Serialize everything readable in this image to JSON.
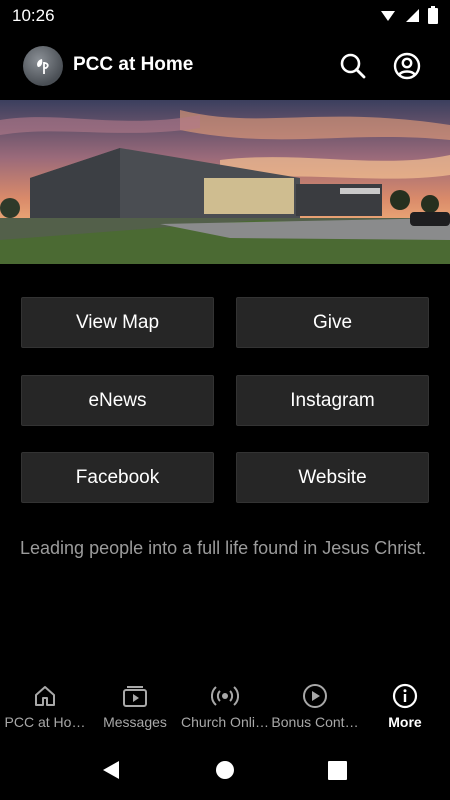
{
  "status_bar": {
    "time": "10:26"
  },
  "app_bar": {
    "title": "PCC at Home",
    "icons": [
      "search-icon",
      "account-icon"
    ]
  },
  "hero": {
    "icon": "church-building-photo"
  },
  "actions": [
    {
      "label": "View Map"
    },
    {
      "label": "Give"
    },
    {
      "label": "eNews"
    },
    {
      "label": "Instagram"
    },
    {
      "label": "Facebook"
    },
    {
      "label": "Website"
    }
  ],
  "tagline": "Leading people into a full life found in Jesus Christ.",
  "bottom_nav": {
    "items": [
      {
        "label": "PCC at Ho…",
        "icon": "home-icon",
        "active": false
      },
      {
        "label": "Messages",
        "icon": "video-library-icon",
        "active": false
      },
      {
        "label": "Church Onli…",
        "icon": "broadcast-icon",
        "active": false
      },
      {
        "label": "Bonus Cont…",
        "icon": "play-circle-icon",
        "active": false
      },
      {
        "label": "More",
        "icon": "info-icon",
        "active": true
      }
    ]
  },
  "colors": {
    "background": "#000000",
    "button_bg": "#262626",
    "tagline": "#9b9b9b",
    "inactive_nav": "#a8a8a8"
  }
}
